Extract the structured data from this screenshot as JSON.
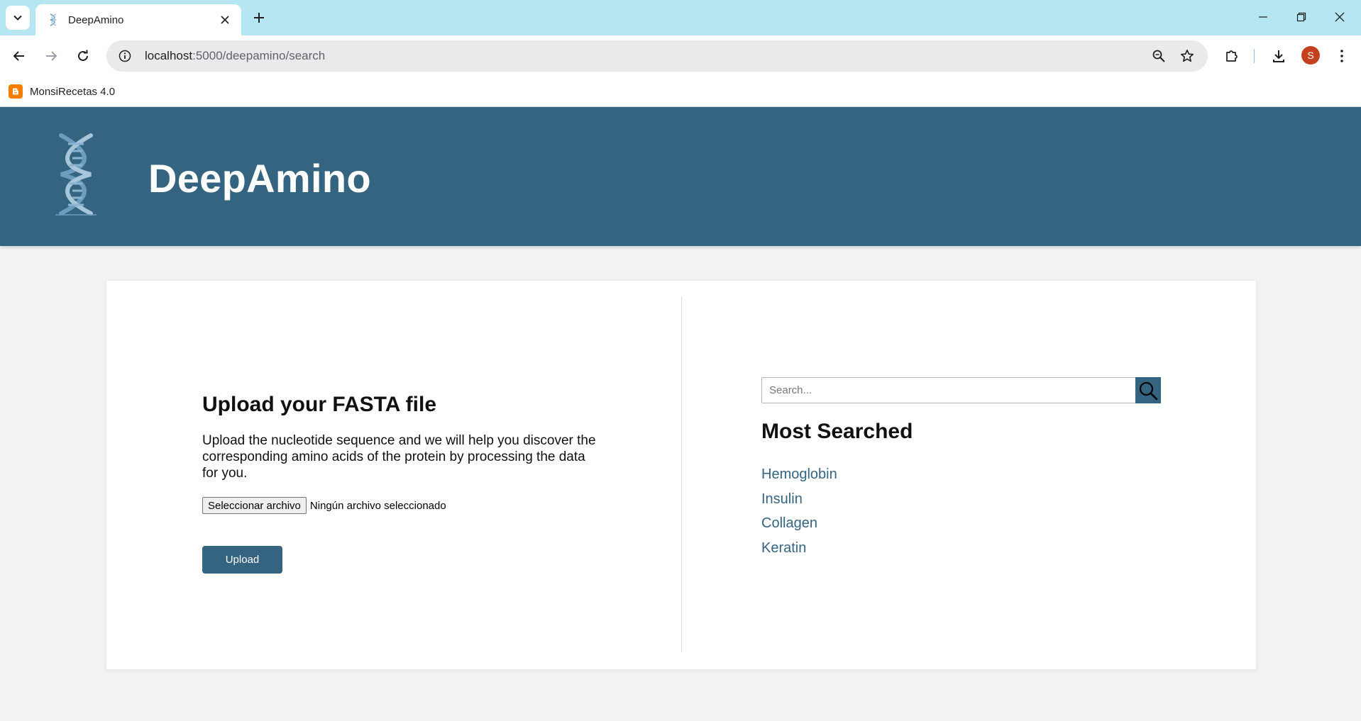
{
  "browser": {
    "tab_title": "DeepAmino",
    "url_host": "localhost",
    "url_path": ":5000/deepamino/search",
    "bookmark_label": "MonsiRecetas 4.0",
    "avatar_letter": "S"
  },
  "header": {
    "title": "DeepAmino"
  },
  "upload": {
    "title": "Upload your FASTA file",
    "description": "Upload the nucleotide sequence and we will help you discover the corresponding amino acids of the protein by processing the data for you.",
    "file_button_label": "Seleccionar archivo",
    "file_status": "Ningún archivo seleccionado",
    "submit_label": "Upload"
  },
  "search": {
    "placeholder": "Search...",
    "value": ""
  },
  "most_searched": {
    "title": "Most Searched",
    "items": [
      "Hemoglobin",
      "Insulin",
      "Collagen",
      "Keratin"
    ]
  },
  "colors": {
    "brand": "#356481",
    "tabstrip": "#b6e6f1",
    "avatar": "#c4401f",
    "bookmark_icon": "#f57d00"
  },
  "icons": {
    "tab_search": "chevron-down-icon",
    "favicon": "dna-icon",
    "tab_close": "close-icon",
    "new_tab": "plus-icon",
    "back": "arrow-left-icon",
    "forward": "arrow-right-icon",
    "reload": "reload-icon",
    "site_info": "info-icon",
    "zoom": "zoom-icon",
    "bookmark": "star-icon",
    "extensions": "puzzle-icon",
    "downloads": "download-icon",
    "menu": "kebab-icon",
    "search_button": "search-icon"
  }
}
